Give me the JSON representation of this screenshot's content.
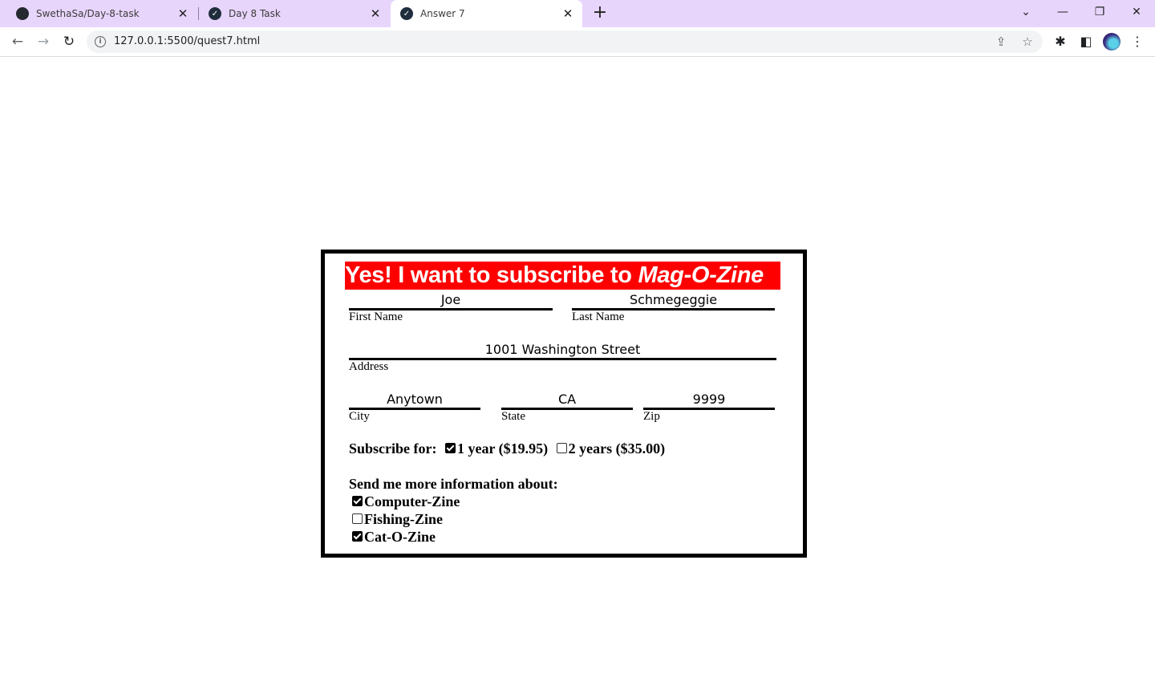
{
  "browser": {
    "tabs": [
      {
        "title": "SwethaSa/Day-8-task",
        "icon": "github-icon"
      },
      {
        "title": "Day 8 Task",
        "icon": "check-circle-icon"
      },
      {
        "title": "Answer 7",
        "icon": "check-circle-icon",
        "active": true
      }
    ],
    "url": "127.0.0.1:5500/quest7.html"
  },
  "form": {
    "heading_main": "Yes! I want to subscribe to ",
    "heading_brand": "Mag-O-Zine",
    "first_name": {
      "value": "Joe",
      "label": "First Name"
    },
    "last_name": {
      "value": "Schmegeggie",
      "label": "Last Name"
    },
    "address": {
      "value": "1001 Washington Street",
      "label": "Address"
    },
    "city": {
      "value": "Anytown",
      "label": "City"
    },
    "state": {
      "value": "CA",
      "label": "State"
    },
    "zip": {
      "value": "9999",
      "label": "Zip"
    },
    "subscribe_label": "Subscribe for:",
    "subscribe_options": [
      {
        "label": "1 year ($19.95)",
        "checked": true
      },
      {
        "label": "2 years ($35.00)",
        "checked": false
      }
    ],
    "info_label": "Send me more information about:",
    "info_options": [
      {
        "label": "Computer-Zine",
        "checked": true
      },
      {
        "label": "Fishing-Zine",
        "checked": false
      },
      {
        "label": "Cat-O-Zine",
        "checked": true
      }
    ]
  }
}
